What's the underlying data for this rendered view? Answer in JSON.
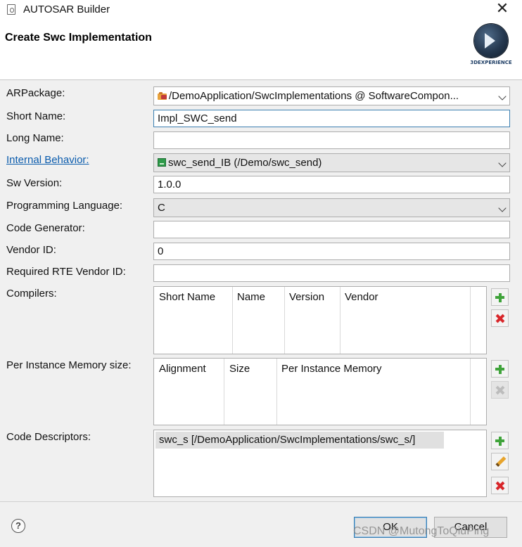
{
  "window": {
    "title": "AUTOSAR Builder",
    "close_glyph": "✕"
  },
  "banner": {
    "title": "Create Swc Implementation",
    "logo_text": "3DEXPERIENCE"
  },
  "form": {
    "arpackage": {
      "label": "ARPackage:",
      "value": "/DemoApplication/SwcImplementations @ SoftwareCompon...",
      "icon": "package-folder-icon"
    },
    "short_name": {
      "label": "Short Name:",
      "value": "Impl_SWC_send"
    },
    "long_name": {
      "label": "Long Name:",
      "value": ""
    },
    "internal_behavior": {
      "label": "Internal Behavior:",
      "value": "swc_send_IB (/Demo/swc_send)",
      "icon": "internal-behavior-icon"
    },
    "sw_version": {
      "label": "Sw Version:",
      "value": "1.0.0"
    },
    "programming_language": {
      "label": "Programming Language:",
      "value": "C"
    },
    "code_generator": {
      "label": "Code Generator:",
      "value": ""
    },
    "vendor_id": {
      "label": "Vendor ID:",
      "value": "0"
    },
    "required_rte_vendor_id": {
      "label": "Required RTE Vendor ID:",
      "value": ""
    }
  },
  "compilers": {
    "label": "Compilers:",
    "columns": [
      "Short Name",
      "Name",
      "Version",
      "Vendor"
    ],
    "rows": []
  },
  "per_instance_memory": {
    "label": "Per Instance Memory size:",
    "columns": [
      "Alignment",
      "Size",
      "Per Instance Memory"
    ],
    "rows": []
  },
  "code_descriptors": {
    "label": "Code Descriptors:",
    "rows": [
      "swc_s [/DemoApplication/SwcImplementations/swc_s/]"
    ]
  },
  "footer": {
    "help_glyph": "?",
    "ok_label": "OK",
    "cancel_label": "Cancel",
    "watermark": "CSDN @MutongToQiuPing"
  },
  "colors": {
    "link": "#0b5cad",
    "add": "#3fa33a",
    "remove": "#d8262a",
    "focus_border": "#3c7fb1"
  }
}
